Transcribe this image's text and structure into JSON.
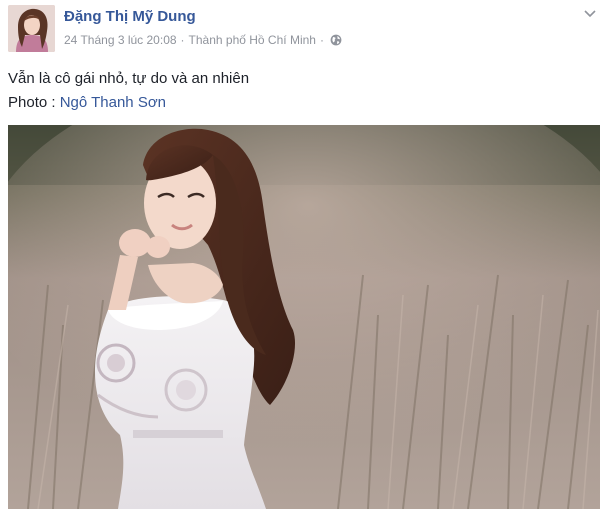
{
  "post": {
    "author": "Đặng Thị Mỹ Dung",
    "timestamp": "24 Tháng 3 lúc 20:08",
    "separator": "·",
    "location": "Thành phố Hồ Chí Minh",
    "privacy_icon": "globe-icon",
    "menu_icon": "chevron-down-icon",
    "caption": "Vẫn là cô gái nhỏ, tự do và an nhiên",
    "credit_prefix": "Photo : ",
    "credit_name": "Ngô Thanh Sơn"
  },
  "colors": {
    "link": "#365899",
    "text": "#1d2129",
    "meta": "#90949c",
    "background": "#ffffff"
  }
}
